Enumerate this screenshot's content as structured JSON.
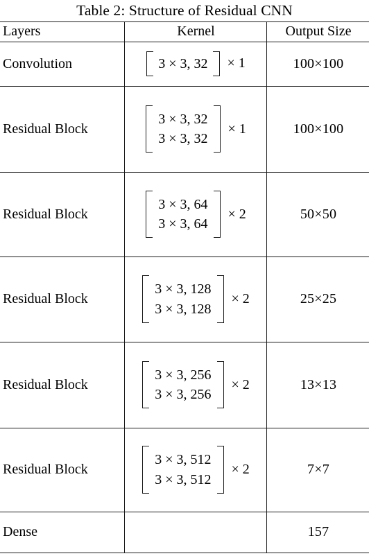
{
  "caption": "Table 2: Structure of Residual CNN",
  "table": {
    "headers": {
      "layers": "Layers",
      "kernel": "Kernel",
      "output": "Output Size"
    },
    "rows": [
      {
        "layer": "Convolution",
        "kernel_lines": [
          "3 × 3, 32"
        ],
        "repeat": "× 1",
        "output": "100×100"
      },
      {
        "layer": "Residual Block",
        "kernel_lines": [
          "3 × 3, 32",
          "3 × 3, 32"
        ],
        "repeat": "× 1",
        "output": "100×100"
      },
      {
        "layer": "Residual Block",
        "kernel_lines": [
          "3 × 3, 64",
          "3 × 3, 64"
        ],
        "repeat": "× 2",
        "output": "50×50"
      },
      {
        "layer": "Residual Block",
        "kernel_lines": [
          "3 × 3, 128",
          "3 × 3, 128"
        ],
        "repeat": "× 2",
        "output": "25×25"
      },
      {
        "layer": "Residual Block",
        "kernel_lines": [
          "3 × 3, 256",
          "3 × 3, 256"
        ],
        "repeat": "× 2",
        "output": "13×13"
      },
      {
        "layer": "Residual Block",
        "kernel_lines": [
          "3 × 3, 512",
          "3 × 3, 512"
        ],
        "repeat": "× 2",
        "output": "7×7"
      },
      {
        "layer": "Dense",
        "kernel_lines": [],
        "repeat": "",
        "output": "157"
      }
    ]
  },
  "style": {
    "rule_color": "#1a1a1a",
    "text_color": "#000000",
    "background": "#ffffff"
  }
}
